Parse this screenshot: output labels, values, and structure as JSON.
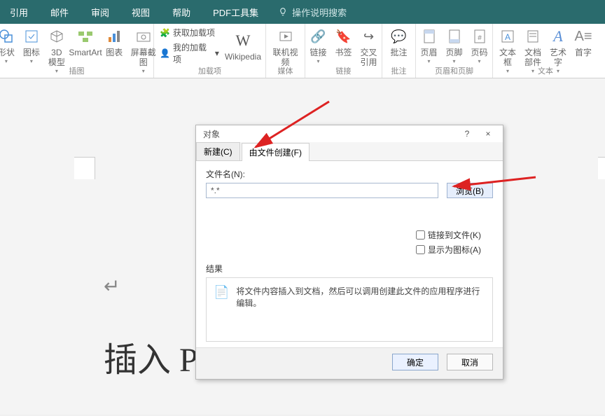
{
  "ribbon": {
    "tabs": [
      "引用",
      "邮件",
      "审阅",
      "视图",
      "帮助",
      "PDF工具集"
    ],
    "search_placeholder": "操作说明搜索",
    "groups": {
      "illustration": {
        "label": "插图",
        "items": {
          "shapes": "形状",
          "icons": "图标",
          "models3d": "3D\n模型",
          "smartart": "SmartArt",
          "chart": "图表",
          "screenshot": "屏幕截图"
        }
      },
      "addins": {
        "label": "加载项",
        "get": "获取加载项",
        "my": "我的加载项",
        "wikipedia": "Wikipedia"
      },
      "media": {
        "label": "媒体",
        "video": "联机视频"
      },
      "links": {
        "label": "链接",
        "link": "链接",
        "bookmark": "书签",
        "crossref": "交叉引用"
      },
      "comments": {
        "label": "批注",
        "comment": "批注"
      },
      "headerfooter": {
        "label": "页眉和页脚",
        "header": "页眉",
        "footer": "页脚",
        "pagenum": "页码"
      },
      "text": {
        "label": "文本",
        "textbox": "文本框",
        "docparts": "文档部件",
        "wordart": "艺术字",
        "dropcap": "首字"
      }
    }
  },
  "dialog": {
    "title": "对象",
    "tab_new": "新建(C)",
    "tab_fromfile": "由文件创建(F)",
    "filename_label": "文件名(N):",
    "filename_value": "*.*",
    "browse": "浏览(B)",
    "link_to_file": "链接到文件(K)",
    "display_as_icon": "显示为图标(A)",
    "result_label": "结果",
    "result_text": "将文件内容插入到文档，然后可以调用创建此文件的应用程序进行编辑。",
    "ok": "确定",
    "cancel": "取消",
    "help": "?",
    "close": "×"
  },
  "document": {
    "body_text": "插入 PDF:"
  }
}
